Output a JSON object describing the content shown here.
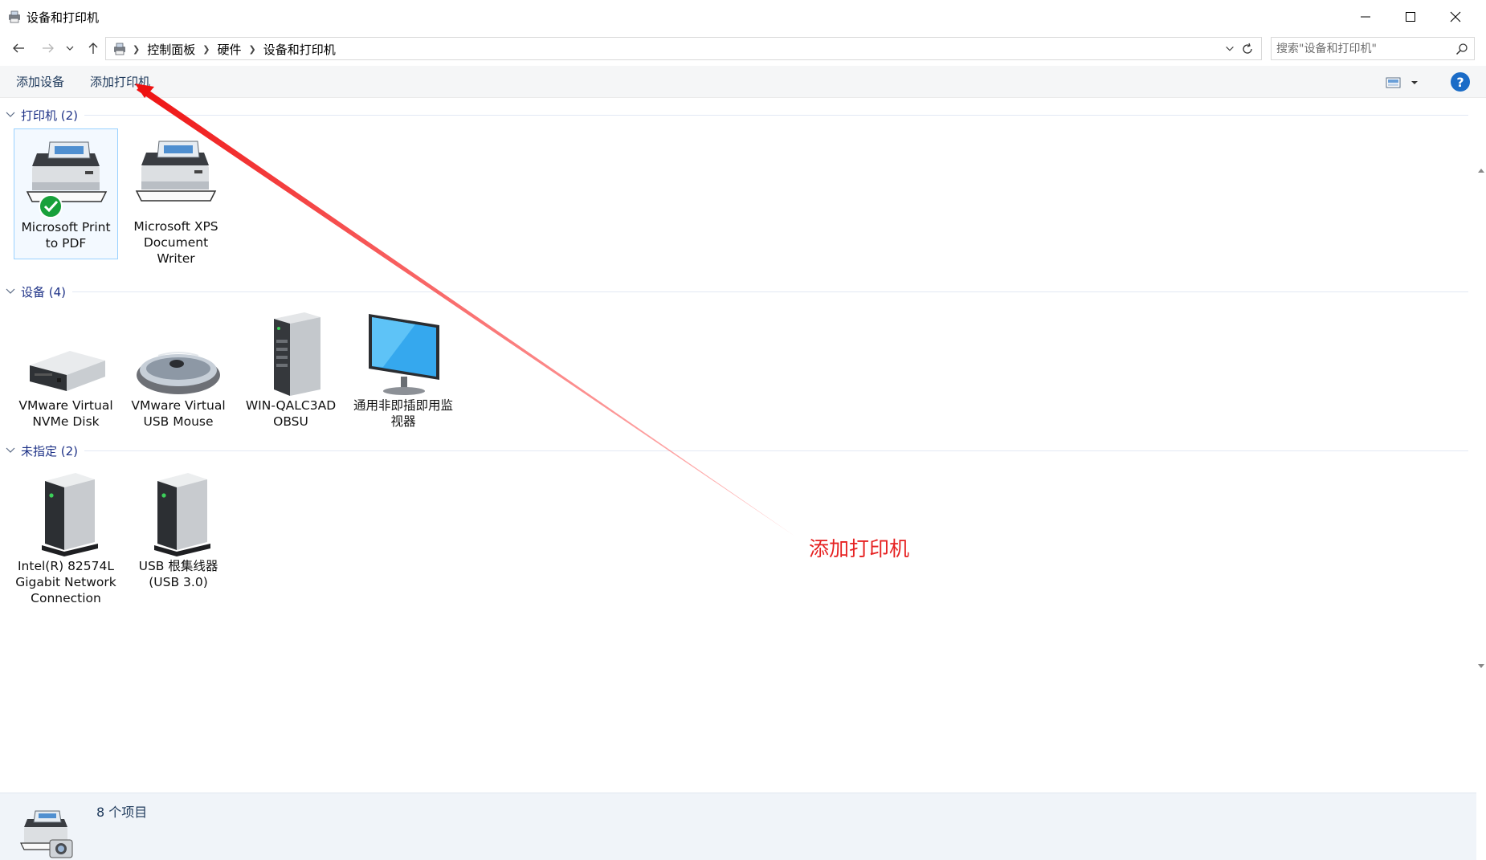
{
  "window": {
    "title": "设备和打印机"
  },
  "address": {
    "crumbs": [
      "控制面板",
      "硬件",
      "设备和打印机"
    ]
  },
  "search": {
    "placeholder": "搜索\"设备和打印机\""
  },
  "commands": {
    "add_device": "添加设备",
    "add_printer": "添加打印机",
    "help": "?"
  },
  "groups": [
    {
      "label": "打印机 (2)",
      "items": [
        {
          "label": "Microsoft Print to PDF",
          "icon": "printer-icon",
          "default": true
        },
        {
          "label": "Microsoft XPS Document Writer",
          "icon": "printer-icon",
          "default": false
        }
      ]
    },
    {
      "label": "设备 (4)",
      "items": [
        {
          "label": "VMware Virtual NVMe Disk",
          "icon": "disk-drive-icon"
        },
        {
          "label": "VMware Virtual USB Mouse",
          "icon": "mouse-icon"
        },
        {
          "label": "WIN-QALC3AD OBSU",
          "icon": "computer-tower-icon"
        },
        {
          "label": "通用非即插即用监视器",
          "icon": "monitor-icon"
        }
      ]
    },
    {
      "label": "未指定 (2)",
      "items": [
        {
          "label": "Intel(R) 82574L Gigabit Network Connection",
          "icon": "device-box-icon"
        },
        {
          "label": "USB 根集线器 (USB 3.0)",
          "icon": "device-box-icon"
        }
      ]
    }
  ],
  "annotation": {
    "text": "添加打印机",
    "color": "#e62222"
  },
  "status": {
    "count": "8 个项目"
  },
  "colors": {
    "link": "#1e395b",
    "group_header": "#1e3287",
    "selection_border": "#99d1ff",
    "help_blue": "#1b6cc7"
  }
}
